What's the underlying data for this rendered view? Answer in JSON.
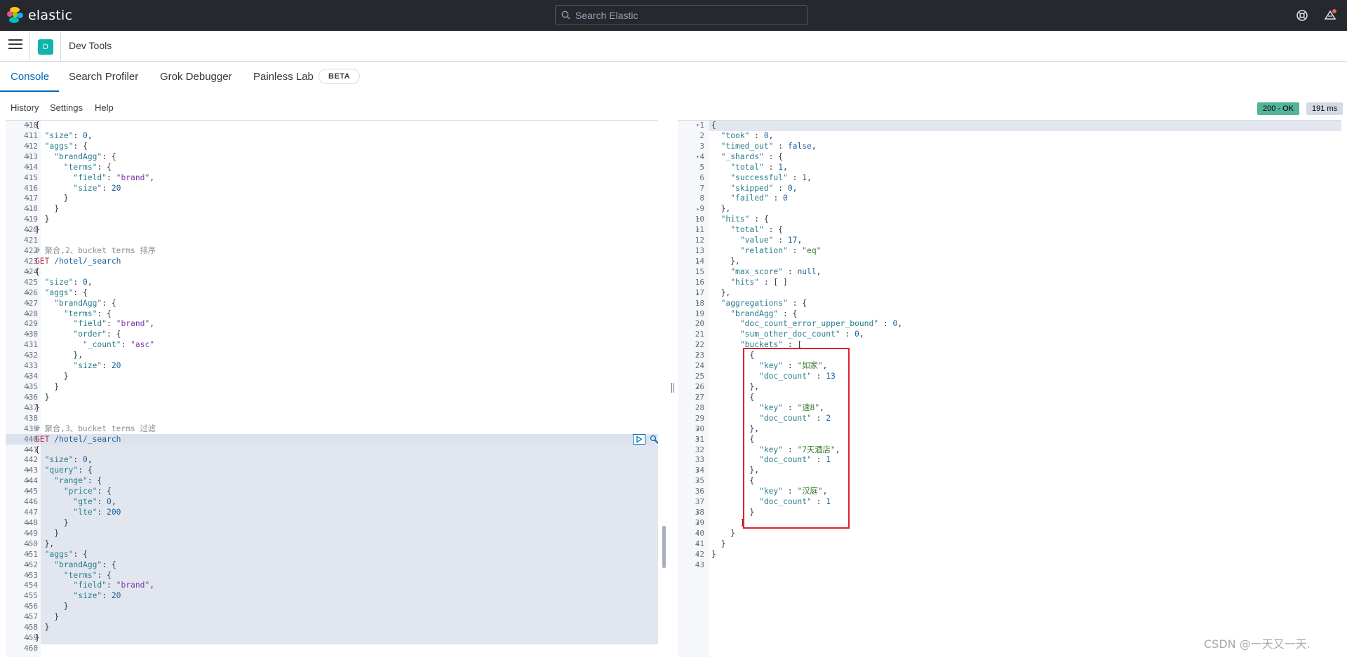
{
  "header": {
    "brand": "elastic",
    "search_placeholder": "Search Elastic",
    "colors": {
      "topbar": "#25282f",
      "accent": "#006bb8",
      "ok": "#54b399"
    }
  },
  "breadcrumb": {
    "app_badge": "D",
    "title": "Dev Tools"
  },
  "tabs": [
    {
      "label": "Console",
      "active": true
    },
    {
      "label": "Search Profiler"
    },
    {
      "label": "Grok Debugger"
    },
    {
      "label": "Painless Lab"
    }
  ],
  "beta_badge": "BETA",
  "toolbar": {
    "history": "History",
    "settings": "Settings",
    "help": "Help"
  },
  "response_status": {
    "code": "200 - OK",
    "time": "191 ms"
  },
  "editor_lines": [
    {
      "n": "410",
      "f": "▾",
      "html": "{"
    },
    {
      "n": "411",
      "f": "",
      "html": "  <span class=\"k\">\"size\"</span>: <span class=\"n\">0</span>,"
    },
    {
      "n": "412",
      "f": "▾",
      "html": "  <span class=\"k\">\"aggs\"</span>: {"
    },
    {
      "n": "413",
      "f": "▾",
      "html": "    <span class=\"k\">\"brandAgg\"</span>: {"
    },
    {
      "n": "414",
      "f": "▾",
      "html": "      <span class=\"k\">\"terms\"</span>: {"
    },
    {
      "n": "415",
      "f": "",
      "html": "        <span class=\"k\">\"field\"</span>: <span class=\"s\">\"brand\"</span>,"
    },
    {
      "n": "416",
      "f": "",
      "html": "        <span class=\"k\">\"size\"</span>: <span class=\"n\">20</span>"
    },
    {
      "n": "417",
      "f": "▴",
      "html": "      }"
    },
    {
      "n": "418",
      "f": "▴",
      "html": "    }"
    },
    {
      "n": "419",
      "f": "▴",
      "html": "  }"
    },
    {
      "n": "420",
      "f": "▴",
      "html": "}"
    },
    {
      "n": "421",
      "f": "",
      "html": ""
    },
    {
      "n": "422",
      "f": "",
      "html": "<span class=\"cm\"># 聚合,2、bucket terms 排序</span>"
    },
    {
      "n": "423",
      "f": "",
      "html": "<span class=\"get\">GET</span> <span class=\"url\">/hotel/_search</span>"
    },
    {
      "n": "424",
      "f": "▾",
      "html": "{"
    },
    {
      "n": "425",
      "f": "",
      "html": "  <span class=\"k\">\"size\"</span>: <span class=\"n\">0</span>,"
    },
    {
      "n": "426",
      "f": "▾",
      "html": "  <span class=\"k\">\"aggs\"</span>: {"
    },
    {
      "n": "427",
      "f": "▾",
      "html": "    <span class=\"k\">\"brandAgg\"</span>: {"
    },
    {
      "n": "428",
      "f": "▾",
      "html": "      <span class=\"k\">\"terms\"</span>: {"
    },
    {
      "n": "429",
      "f": "",
      "html": "        <span class=\"k\">\"field\"</span>: <span class=\"s\">\"brand\"</span>,"
    },
    {
      "n": "430",
      "f": "▾",
      "html": "        <span class=\"k\">\"order\"</span>: {"
    },
    {
      "n": "431",
      "f": "",
      "html": "          <span class=\"k\">\"_count\"</span>: <span class=\"s\">\"asc\"</span>"
    },
    {
      "n": "432",
      "f": "▴",
      "html": "        },"
    },
    {
      "n": "433",
      "f": "",
      "html": "        <span class=\"k\">\"size\"</span>: <span class=\"n\">20</span>"
    },
    {
      "n": "434",
      "f": "▴",
      "html": "      }"
    },
    {
      "n": "435",
      "f": "▴",
      "html": "    }"
    },
    {
      "n": "436",
      "f": "▴",
      "html": "  }"
    },
    {
      "n": "437",
      "f": "▴",
      "html": "}"
    },
    {
      "n": "438",
      "f": "",
      "html": ""
    },
    {
      "n": "439",
      "f": "",
      "html": "<span class=\"cm\"># 聚合,3、bucket terms 过滤</span>"
    },
    {
      "n": "440",
      "f": "",
      "html": "<span class=\"get\">GET</span> <span class=\"url\">/hotel/_search</span>"
    },
    {
      "n": "441",
      "f": "▾",
      "html": "{"
    },
    {
      "n": "442",
      "f": "",
      "html": "  <span class=\"k\">\"size\"</span>: <span class=\"n\">0</span>,"
    },
    {
      "n": "443",
      "f": "▾",
      "html": "  <span class=\"k\">\"query\"</span>: {"
    },
    {
      "n": "444",
      "f": "▾",
      "html": "    <span class=\"k\">\"range\"</span>: {"
    },
    {
      "n": "445",
      "f": "▾",
      "html": "      <span class=\"k\">\"price\"</span>: {"
    },
    {
      "n": "446",
      "f": "",
      "html": "        <span class=\"k\">\"gte\"</span>: <span class=\"n\">0</span>,"
    },
    {
      "n": "447",
      "f": "",
      "html": "        <span class=\"k\">\"lte\"</span>: <span class=\"n\">200</span>"
    },
    {
      "n": "448",
      "f": "▴",
      "html": "      }"
    },
    {
      "n": "449",
      "f": "▴",
      "html": "    }"
    },
    {
      "n": "450",
      "f": "▴",
      "html": "  },"
    },
    {
      "n": "451",
      "f": "▾",
      "html": "  <span class=\"k\">\"aggs\"</span>: {"
    },
    {
      "n": "452",
      "f": "▾",
      "html": "    <span class=\"k\">\"brandAgg\"</span>: {"
    },
    {
      "n": "453",
      "f": "▾",
      "html": "      <span class=\"k\">\"terms\"</span>: {"
    },
    {
      "n": "454",
      "f": "",
      "html": "        <span class=\"k\">\"field\"</span>: <span class=\"s\">\"brand\"</span>,"
    },
    {
      "n": "455",
      "f": "",
      "html": "        <span class=\"k\">\"size\"</span>: <span class=\"n\">20</span>"
    },
    {
      "n": "456",
      "f": "▴",
      "html": "      }"
    },
    {
      "n": "457",
      "f": "▴",
      "html": "    }"
    },
    {
      "n": "458",
      "f": "▴",
      "html": "  }"
    },
    {
      "n": "459",
      "f": "▴",
      "html": "}"
    },
    {
      "n": "460",
      "f": "",
      "html": ""
    }
  ],
  "output_lines": [
    {
      "n": "1",
      "f": "▾",
      "html": "{"
    },
    {
      "n": "2",
      "f": "",
      "html": "  <span class=\"ok\">\"took\"</span> : <span class=\"onum\">0</span>,"
    },
    {
      "n": "3",
      "f": "",
      "html": "  <span class=\"ok\">\"timed_out\"</span> : <span class=\"onum\">false</span>,"
    },
    {
      "n": "4",
      "f": "▾",
      "html": "  <span class=\"ok\">\"_shards\"</span> : {"
    },
    {
      "n": "5",
      "f": "",
      "html": "    <span class=\"ok\">\"total\"</span> : <span class=\"onum\">1</span>,"
    },
    {
      "n": "6",
      "f": "",
      "html": "    <span class=\"ok\">\"successful\"</span> : <span class=\"onum\">1</span>,"
    },
    {
      "n": "7",
      "f": "",
      "html": "    <span class=\"ok\">\"skipped\"</span> : <span class=\"onum\">0</span>,"
    },
    {
      "n": "8",
      "f": "",
      "html": "    <span class=\"ok\">\"failed\"</span> : <span class=\"onum\">0</span>"
    },
    {
      "n": "9",
      "f": "▴",
      "html": "  },"
    },
    {
      "n": "10",
      "f": "▾",
      "html": "  <span class=\"ok\">\"hits\"</span> : {"
    },
    {
      "n": "11",
      "f": "▾",
      "html": "    <span class=\"ok\">\"total\"</span> : {"
    },
    {
      "n": "12",
      "f": "",
      "html": "      <span class=\"ok\">\"value\"</span> : <span class=\"onum\">17</span>,"
    },
    {
      "n": "13",
      "f": "",
      "html": "      <span class=\"ok\">\"relation\"</span> : <span class=\"ostr\">\"eq\"</span>"
    },
    {
      "n": "14",
      "f": "▴",
      "html": "    },"
    },
    {
      "n": "15",
      "f": "",
      "html": "    <span class=\"ok\">\"max_score\"</span> : <span class=\"onum\">null</span>,"
    },
    {
      "n": "16",
      "f": "",
      "html": "    <span class=\"ok\">\"hits\"</span> : [ ]"
    },
    {
      "n": "17",
      "f": "▴",
      "html": "  },"
    },
    {
      "n": "18",
      "f": "▾",
      "html": "  <span class=\"ok\">\"aggregations\"</span> : {"
    },
    {
      "n": "19",
      "f": "▾",
      "html": "    <span class=\"ok\">\"brandAgg\"</span> : {"
    },
    {
      "n": "20",
      "f": "",
      "html": "      <span class=\"ok\">\"doc_count_error_upper_bound\"</span> : <span class=\"onum\">0</span>,"
    },
    {
      "n": "21",
      "f": "",
      "html": "      <span class=\"ok\">\"sum_other_doc_count\"</span> : <span class=\"onum\">0</span>,"
    },
    {
      "n": "22",
      "f": "▾",
      "html": "      <span class=\"ok\">\"buckets\"</span> : ["
    },
    {
      "n": "23",
      "f": "▾",
      "html": "        {"
    },
    {
      "n": "24",
      "f": "",
      "html": "          <span class=\"ok\">\"key\"</span> : <span class=\"ostr\">\"如家\"</span>,"
    },
    {
      "n": "25",
      "f": "",
      "html": "          <span class=\"ok\">\"doc_count\"</span> : <span class=\"onum\">13</span>"
    },
    {
      "n": "26",
      "f": "▴",
      "html": "        },"
    },
    {
      "n": "27",
      "f": "▾",
      "html": "        {"
    },
    {
      "n": "28",
      "f": "",
      "html": "          <span class=\"ok\">\"key\"</span> : <span class=\"ostr\">\"速8\"</span>,"
    },
    {
      "n": "29",
      "f": "",
      "html": "          <span class=\"ok\">\"doc_count\"</span> : <span class=\"onum\">2</span>"
    },
    {
      "n": "30",
      "f": "▴",
      "html": "        },"
    },
    {
      "n": "31",
      "f": "▾",
      "html": "        {"
    },
    {
      "n": "32",
      "f": "",
      "html": "          <span class=\"ok\">\"key\"</span> : <span class=\"ostr\">\"7天酒店\"</span>,"
    },
    {
      "n": "33",
      "f": "",
      "html": "          <span class=\"ok\">\"doc_count\"</span> : <span class=\"onum\">1</span>"
    },
    {
      "n": "34",
      "f": "▴",
      "html": "        },"
    },
    {
      "n": "35",
      "f": "▾",
      "html": "        {"
    },
    {
      "n": "36",
      "f": "",
      "html": "          <span class=\"ok\">\"key\"</span> : <span class=\"ostr\">\"汉庭\"</span>,"
    },
    {
      "n": "37",
      "f": "",
      "html": "          <span class=\"ok\">\"doc_count\"</span> : <span class=\"onum\">1</span>"
    },
    {
      "n": "38",
      "f": "▴",
      "html": "        }"
    },
    {
      "n": "39",
      "f": "▴",
      "html": "      ]"
    },
    {
      "n": "40",
      "f": "▴",
      "html": "    }"
    },
    {
      "n": "41",
      "f": "▴",
      "html": "  }"
    },
    {
      "n": "42",
      "f": "▴",
      "html": "}"
    },
    {
      "n": "43",
      "f": "",
      "html": ""
    }
  ],
  "watermark": "CSDN @一天又一天."
}
